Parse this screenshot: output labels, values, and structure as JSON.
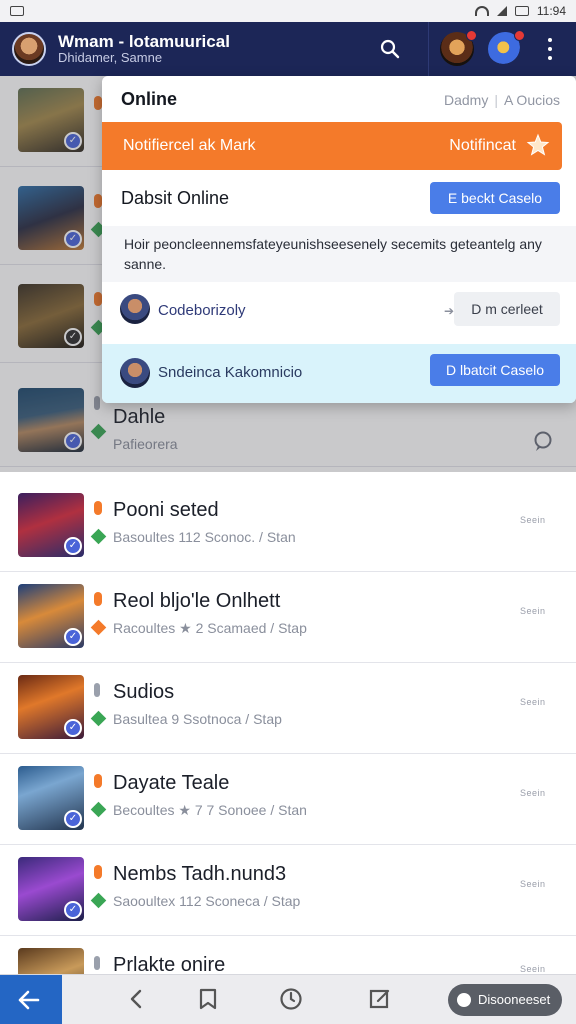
{
  "status_bar": {
    "time": "11:94"
  },
  "header": {
    "title": "Wmam - lotamuurical",
    "subtitle": "Dhidamer, Samne"
  },
  "dropdown": {
    "title": "Online",
    "links": [
      "Dadmy",
      "A Oucios"
    ],
    "notification_left": "Notifiercel ak Mark",
    "notification_right": "Notifincat",
    "section_title": "Dabsit Online",
    "section_button": "E beckt Caselo",
    "message": "Hoir peoncleennemsfateyeunishseesenely secemits geteantelg any sanne.",
    "item1_name": "Codeborizoly",
    "item1_button": "D m cerleet",
    "item2_name": "Sndeinca Kakomnicio",
    "item2_button": "D lbatcit Caselo"
  },
  "list": {
    "rows": [
      {
        "title": "",
        "meta": "",
        "time": "",
        "status": "orange"
      },
      {
        "title": "",
        "meta": "",
        "time": "",
        "status": "orange"
      },
      {
        "title": "",
        "meta": "",
        "time": "",
        "status": "orange"
      },
      {
        "title": "Dahle",
        "meta": "Pafieorera",
        "time": "",
        "status": "gray"
      },
      {
        "title": "Pooni seted",
        "meta": "Basoultes 112 Sconoc. / Stan",
        "time": "Seein",
        "status": "orange"
      },
      {
        "title": "Reol bljo'le Onlhett",
        "meta": "Racoultes ★ 2 Scamaed / Stap",
        "time": "Seein",
        "status": "orange"
      },
      {
        "title": "Sudios",
        "meta": "Basultea 9 Ssotnoca / Stap",
        "time": "Seein",
        "status": "gray"
      },
      {
        "title": "Dayate Teale",
        "meta": "Becoultes ★ 7 7 Sonoee / Stan",
        "time": "Seein",
        "status": "orange"
      },
      {
        "title": "Nembs Tadh.nund3",
        "meta": "Saooultex 112 Sconeca / Stap",
        "time": "Seein",
        "status": "orange"
      },
      {
        "title": "Prlakte onire",
        "meta": "",
        "time": "Seein",
        "status": "gray"
      }
    ]
  },
  "bottom_nav": {
    "pill_label": "Disooneeset"
  },
  "colors": {
    "header_bg": "#1c2657",
    "accent_orange": "#f47a2a",
    "accent_blue": "#4a7de8",
    "cyan_highlight": "#d9f3fb",
    "back_button": "#2466c4"
  }
}
